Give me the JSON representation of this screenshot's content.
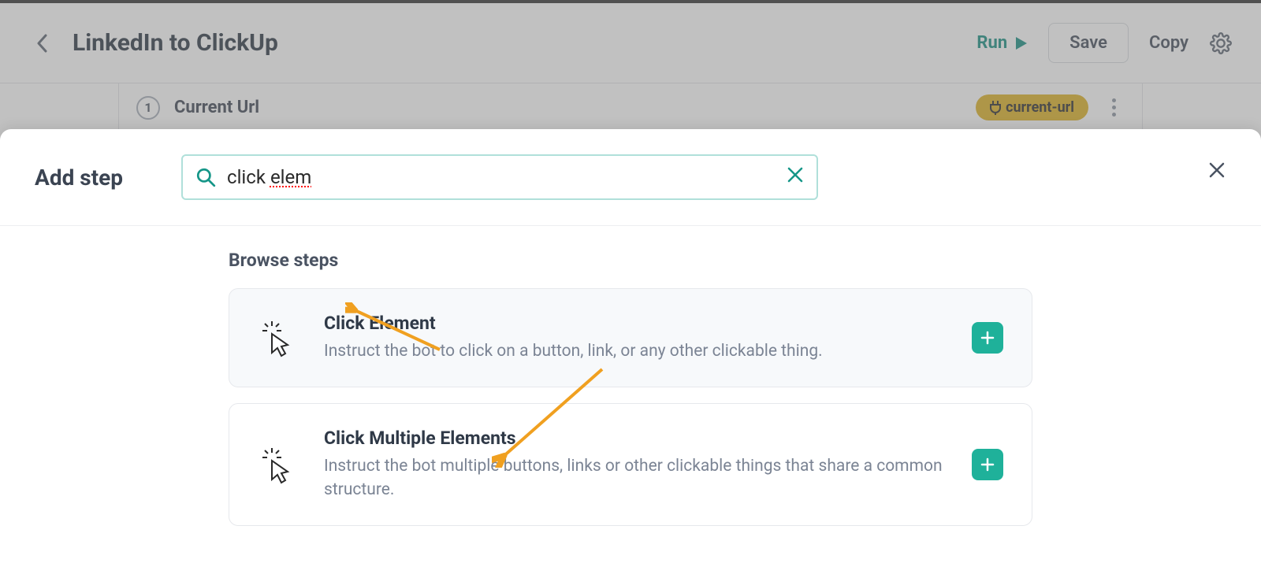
{
  "header": {
    "title": "LinkedIn to ClickUp",
    "run_label": "Run",
    "save_label": "Save",
    "copy_label": "Copy"
  },
  "existing_step": {
    "number": "1",
    "name": "Current Url",
    "badge": "current-url"
  },
  "modal": {
    "title": "Add step",
    "search_value": "click elem",
    "browse_heading": "Browse steps",
    "results": [
      {
        "title": "Click Element",
        "description": "Instruct the bot to click on a button, link, or any other clickable thing."
      },
      {
        "title": "Click Multiple Elements",
        "description": "Instruct the bot multiple buttons, links or other clickable things that share a common structure."
      }
    ]
  }
}
